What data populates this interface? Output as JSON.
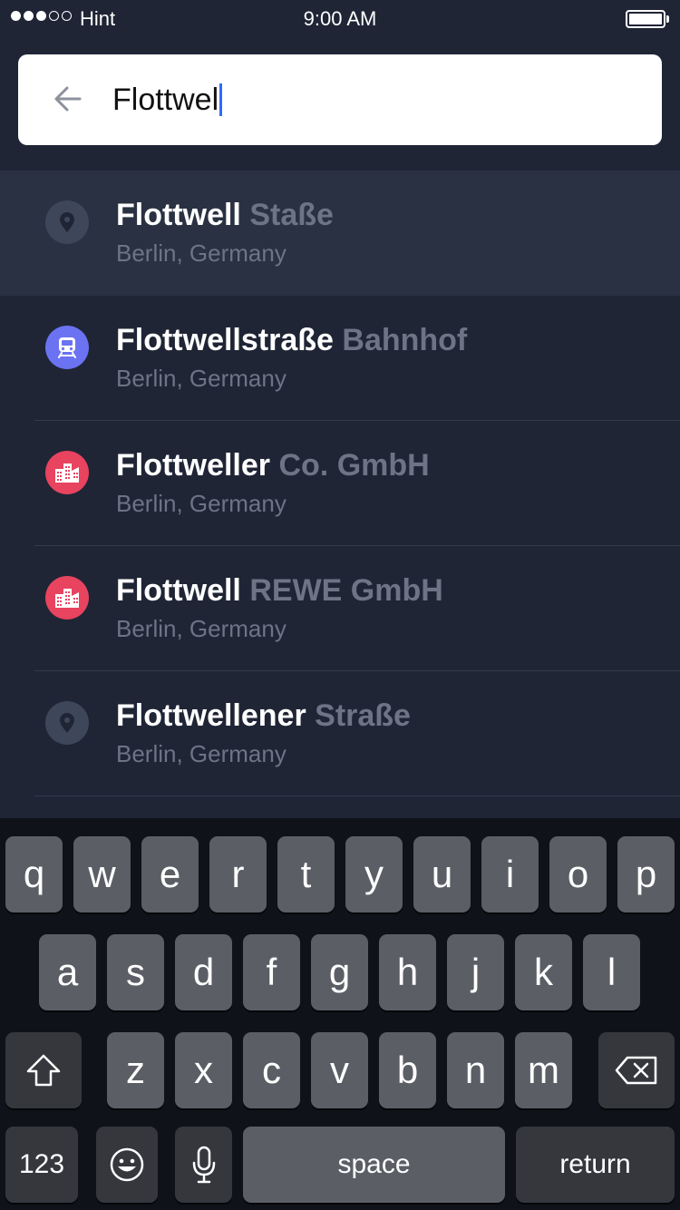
{
  "status_bar": {
    "carrier": "Hint",
    "time": "9:00 AM"
  },
  "search": {
    "query": "Flottwel",
    "back_icon": "arrow-left-icon"
  },
  "colors": {
    "background": "#1f2535",
    "active_row": "#2a3142",
    "muted_text": "#6d7485",
    "station": "#6b73f2",
    "business": "#e8435f",
    "place": "#3e4659",
    "caret": "#2f6cf6"
  },
  "results": [
    {
      "match": "Flottwell",
      "rest": " Staße",
      "location": "Berlin, Germany",
      "icon": "location-pin-icon",
      "type": "place"
    },
    {
      "match": "Flottwellstraße",
      "rest": " Bahnhof",
      "location": "Berlin, Germany",
      "icon": "train-icon",
      "type": "station"
    },
    {
      "match": "Flottweller",
      "rest": " Co. GmbH",
      "location": "Berlin, Germany",
      "icon": "buildings-icon",
      "type": "business"
    },
    {
      "match": "Flottwell",
      "rest": " REWE GmbH",
      "location": "Berlin, Germany",
      "icon": "buildings-icon",
      "type": "business"
    },
    {
      "match": "Flottwellener",
      "rest": " Straße",
      "location": "Berlin, Germany",
      "icon": "location-pin-icon",
      "type": "place"
    }
  ],
  "keyboard": {
    "row1": [
      "q",
      "w",
      "e",
      "r",
      "t",
      "y",
      "u",
      "i",
      "o",
      "p"
    ],
    "row2": [
      "a",
      "s",
      "d",
      "f",
      "g",
      "h",
      "j",
      "k",
      "l"
    ],
    "row3": [
      "z",
      "x",
      "c",
      "v",
      "b",
      "n",
      "m"
    ],
    "numbers_label": "123",
    "space_label": "space",
    "return_label": "return",
    "shift_icon": "shift-icon",
    "delete_icon": "backspace-icon",
    "emoji_icon": "emoji-icon",
    "mic_icon": "microphone-icon"
  }
}
